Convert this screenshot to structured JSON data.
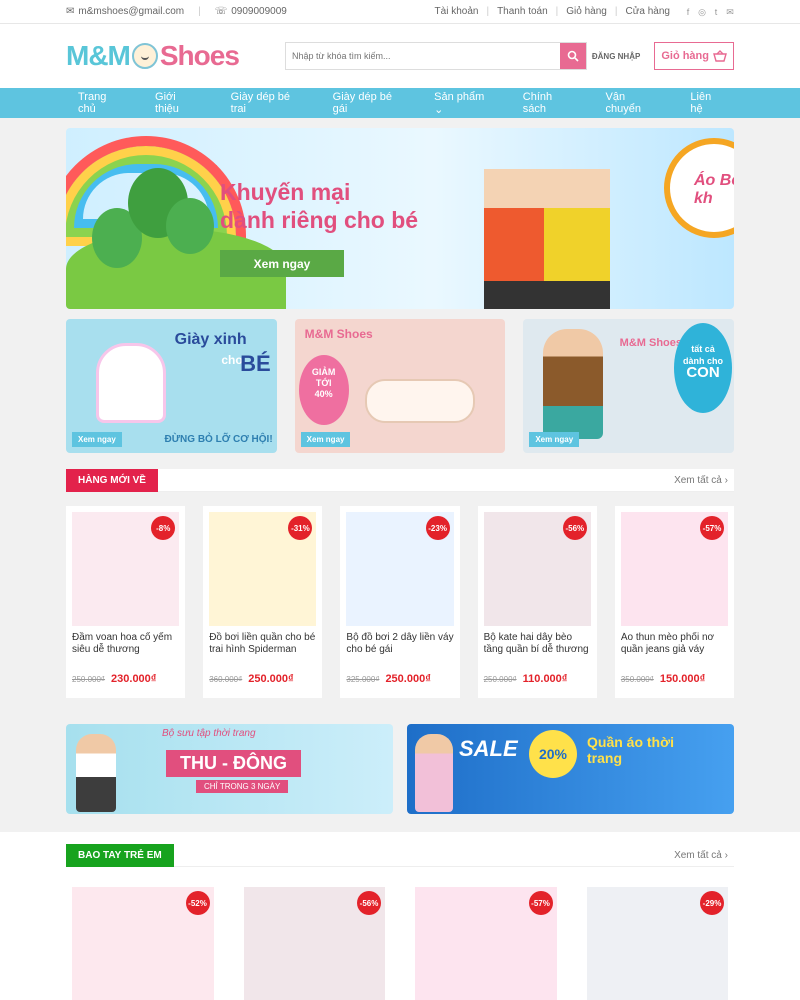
{
  "topbar": {
    "email": "m&mshoes@gmail.com",
    "phone": "0909009009",
    "links": [
      "Tài khoản",
      "Thanh toán",
      "Giỏ hàng",
      "Cửa hàng"
    ]
  },
  "header": {
    "logo_mm": "M&M",
    "logo_shoes": "Shoes",
    "search_placeholder": "Nhập từ khóa tìm kiếm...",
    "login": "ĐĂNG NHẬP",
    "cart": "Giỏ hàng"
  },
  "nav": [
    "Trang chủ",
    "Giới thiệu",
    "Giày dép bé trai",
    "Giày dép bé gái",
    "Sản phẩm",
    "Chính sách",
    "Vận chuyển",
    "Liên hệ"
  ],
  "hero": {
    "line1": "Khuyến mại",
    "line2": "dành riêng cho bé",
    "button": "Xem ngay",
    "corner": "Áo Bé kh"
  },
  "promo": [
    {
      "text1": "Giày xinh",
      "text2": "cho",
      "text3": "BÉ",
      "foot": "ĐỪNG BỎ LỠ CƠ HỘI!",
      "button": "Xem ngay"
    },
    {
      "logo": "M&M Shoes",
      "text1": "GIẢM",
      "text2": "TỚI",
      "text3": "40%",
      "button": "Xem ngay"
    },
    {
      "logo": "M&M Shoes",
      "text1": "tất cả",
      "text2": "dành cho",
      "text3": "CON",
      "button": "Xem ngay"
    }
  ],
  "section1": {
    "title": "HÀNG MỚI VỀ",
    "more": "Xem tất cả",
    "color": "#e3224b",
    "products": [
      {
        "name": "Đầm voan hoa cổ yếm siêu dễ thương",
        "old": "250.000₫",
        "new": "230.000₫",
        "badge": "-8%"
      },
      {
        "name": "Đồ bơi liền quần cho bé trai hình Spiderman",
        "old": "360.000₫",
        "new": "250.000₫",
        "badge": "-31%"
      },
      {
        "name": "Bộ đồ bơi 2 dây liền váy cho bé gái",
        "old": "325.000₫",
        "new": "250.000₫",
        "badge": "-23%"
      },
      {
        "name": "Bộ kate hai dây bèo tầng quần bí dễ thương",
        "old": "250.000₫",
        "new": "110.000₫",
        "badge": "-56%"
      },
      {
        "name": "Áo thun mèo phối nơ quần jeans giả váy",
        "old": "350.000₫",
        "new": "150.000₫",
        "badge": "-57%"
      }
    ]
  },
  "wide": [
    {
      "caption": "Bộ sưu tập thời trang",
      "title": "THU - ĐÔNG",
      "sub": "CHỈ TRONG 3 NGÀY"
    },
    {
      "sale": "SALE",
      "pct": "20%",
      "title": "Quần áo thời trang"
    }
  ],
  "section2": {
    "title": "BAO TAY TRẺ EM",
    "more": "Xem tất cả",
    "color": "#17a31e",
    "products": [
      {
        "badge": "-52%"
      },
      {
        "badge": "-56%"
      },
      {
        "badge": "-57%"
      },
      {
        "badge": "-29%"
      }
    ]
  }
}
